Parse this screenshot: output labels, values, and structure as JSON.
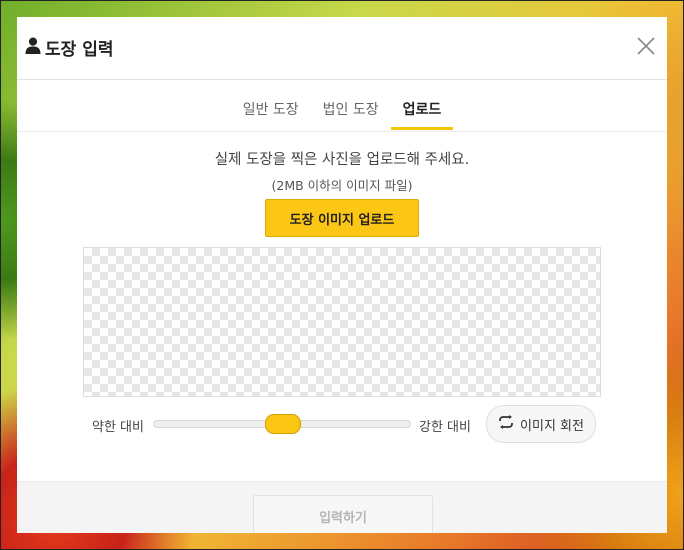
{
  "modal": {
    "title": "도장 입력",
    "title_icon": "person-icon",
    "close_icon": "close-icon"
  },
  "tabs": [
    {
      "label": "일반 도장",
      "active": false
    },
    {
      "label": "법인 도장",
      "active": false
    },
    {
      "label": "업로드",
      "active": true
    }
  ],
  "upload": {
    "message": "실제 도장을 찍은 사진을 업로드해 주세요.",
    "subtext": "(2MB 이하의 이미지 파일)",
    "button_label": "도장 이미지 업로드"
  },
  "contrast": {
    "weak_label": "약한 대비",
    "strong_label": "강한 대비",
    "value": 0.5
  },
  "rotate": {
    "label": "이미지 회전",
    "icon": "rotate-icon"
  },
  "footer": {
    "submit_label": "입력하기"
  },
  "colors": {
    "accent": "#fcc615",
    "tab_underline": "#f5c400"
  }
}
